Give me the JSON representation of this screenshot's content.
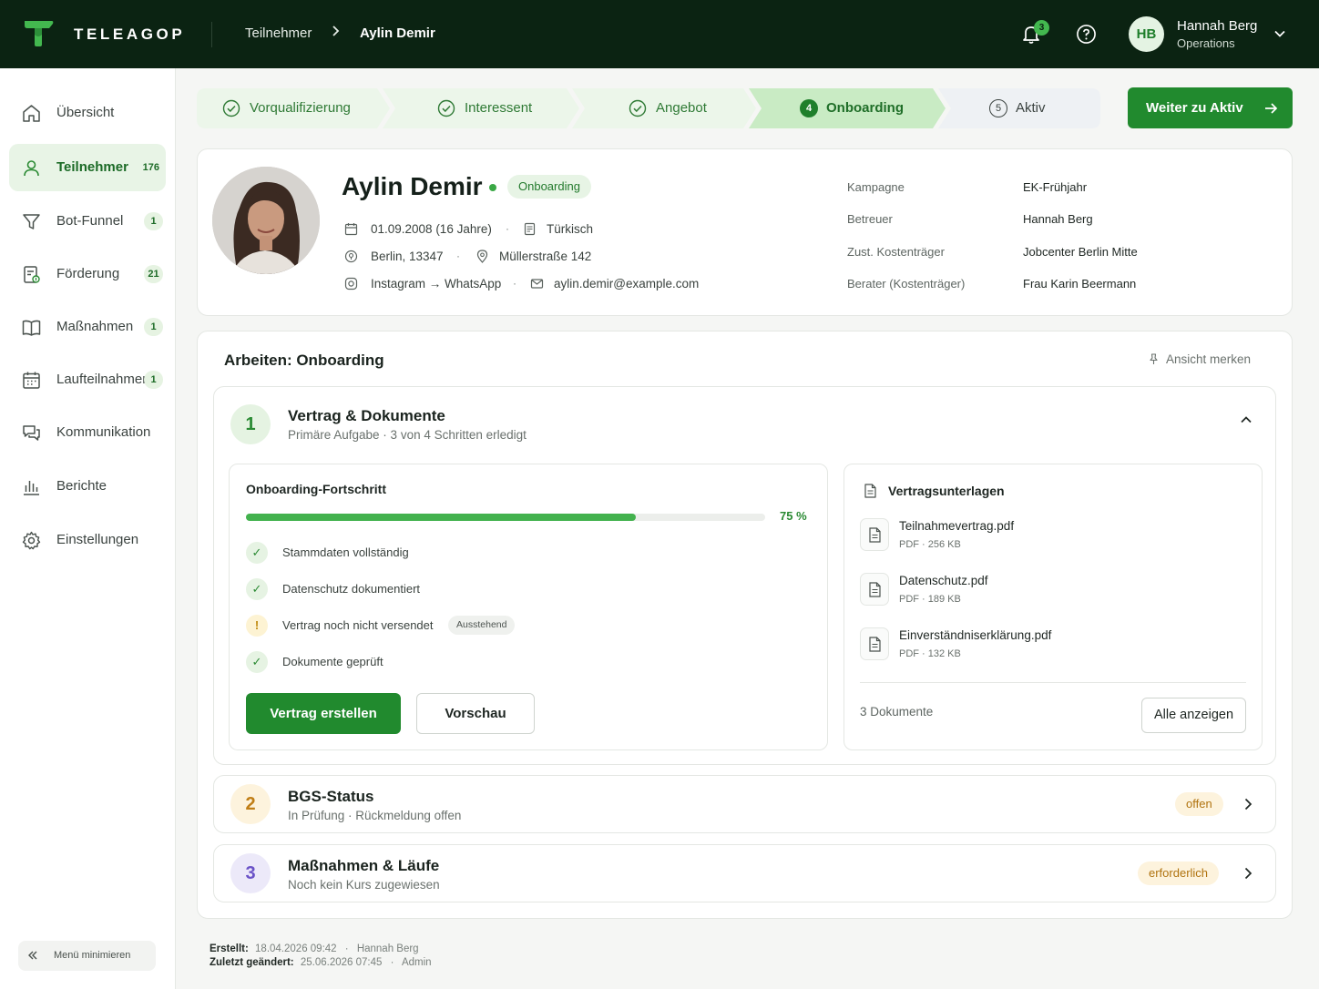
{
  "brand": {
    "name": "TELEAGOP"
  },
  "breadcrumb": {
    "section": "Teilnehmer",
    "current": "Aylin Demir"
  },
  "header": {
    "notifications": "3",
    "user_initials": "HB",
    "user_name": "Hannah Berg",
    "user_role": "Operations"
  },
  "sidebar": {
    "items": [
      {
        "label": "Übersicht",
        "icon": "home-icon",
        "badge": ""
      },
      {
        "label": "Teilnehmer",
        "icon": "user-icon",
        "badge": "176",
        "active": true
      },
      {
        "label": "Bot-Funnel",
        "icon": "funnel-icon",
        "badge": "1"
      },
      {
        "label": "Förderung",
        "icon": "funding-document-icon",
        "badge": "21"
      },
      {
        "label": "Maßnahmen",
        "icon": "book-icon",
        "badge": "1"
      },
      {
        "label": "Laufteilnahmen",
        "icon": "calendar-icon",
        "badge": "1"
      },
      {
        "label": "Kommunikation",
        "icon": "chat-icon",
        "badge": ""
      },
      {
        "label": "Berichte",
        "icon": "bar-chart-icon",
        "badge": ""
      },
      {
        "label": "Einstellungen",
        "icon": "gear-icon",
        "badge": ""
      }
    ],
    "minimize_label": "Menü minimieren"
  },
  "stepper": {
    "steps": [
      {
        "label": "Vorqualifizierung",
        "state": "done"
      },
      {
        "label": "Interessent",
        "state": "done"
      },
      {
        "label": "Angebot",
        "state": "done"
      },
      {
        "label": "Onboarding",
        "state": "current",
        "number": "4"
      },
      {
        "label": "Aktiv",
        "state": "upcoming",
        "number": "5"
      }
    ],
    "next_button": "Weiter zu Aktiv"
  },
  "profile": {
    "name": "Aylin Demir",
    "status": "Onboarding",
    "birthdate": "01.09.2008 (16 Jahre)",
    "language": "Türkisch",
    "city": "Berlin, 13347",
    "street": "Müllerstraße 142",
    "channel": "Instagram → WhatsApp",
    "email": "aylin.demir@example.com",
    "details": [
      {
        "key": "Kampagne",
        "value": "EK-Frühjahr"
      },
      {
        "key": "Betreuer",
        "value": "Hannah Berg"
      },
      {
        "key": "Zust. Kostenträger",
        "value": "Jobcenter Berlin Mitte"
      },
      {
        "key": "Berater (Kostenträger)",
        "value": "Frau Karin Beermann"
      }
    ]
  },
  "work": {
    "title": "Arbeiten: Onboarding",
    "pin_label": "Ansicht merken",
    "section1": {
      "number": "1",
      "title": "Vertrag & Dokumente",
      "subtitle": "Primäre Aufgabe · 3 von 4 Schritten erledigt",
      "progress": {
        "title": "Onboarding-Fortschritt",
        "percent": 75,
        "percent_label": "75 %",
        "items": [
          {
            "label": "Stammdaten vollständig",
            "state": "done",
            "pill": ""
          },
          {
            "label": "Datenschutz dokumentiert",
            "state": "done",
            "pill": ""
          },
          {
            "label": "Vertrag noch nicht versendet",
            "state": "warn",
            "pill": "Ausstehend"
          },
          {
            "label": "Dokumente geprüft",
            "state": "done",
            "pill": ""
          }
        ],
        "primary_button": "Vertrag erstellen",
        "secondary_button": "Vorschau"
      },
      "documents": {
        "title": "Vertragsunterlagen",
        "files": [
          {
            "name": "Teilnahmevertrag.pdf",
            "meta": "PDF · 256 KB"
          },
          {
            "name": "Datenschutz.pdf",
            "meta": "PDF · 189 KB"
          },
          {
            "name": "Einverständniserklärung.pdf",
            "meta": "PDF · 132 KB"
          }
        ],
        "count": "3 Dokumente",
        "show_all": "Alle anzeigen"
      }
    },
    "section2": {
      "number": "2",
      "title": "BGS-Status",
      "subtitle": "In Prüfung · Rückmeldung offen",
      "status": "offen"
    },
    "section3": {
      "number": "3",
      "title": "Maßnahmen & Läufe",
      "subtitle": "Noch kein Kurs zugewiesen",
      "status": "erforderlich"
    }
  },
  "footer": {
    "created_label": "Erstellt:",
    "created_value": "18.04.2026 09:42",
    "created_by": "Hannah Berg",
    "changed_label": "Zuletzt geändert:",
    "changed_value": "25.06.2026 07:45",
    "changed_by": "Admin"
  },
  "colors": {
    "brand_dark": "#0b2312",
    "accent": "#218a2e",
    "accent_light": "#e8f4e6",
    "warning": "#c08b10"
  }
}
